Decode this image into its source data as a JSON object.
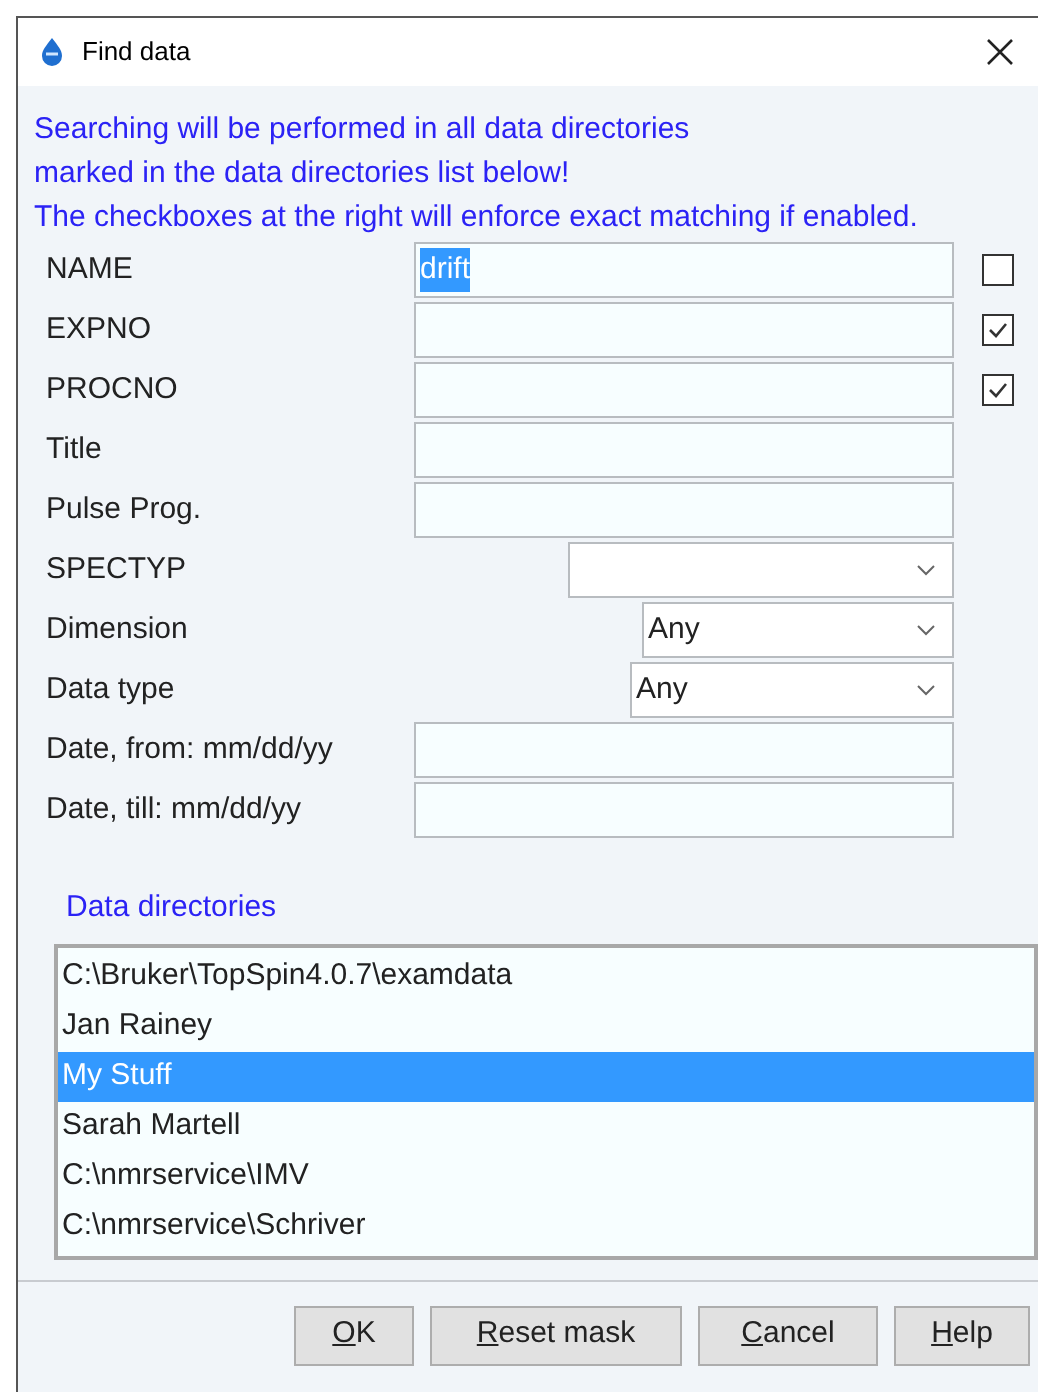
{
  "window": {
    "title": "Find data"
  },
  "info_lines": [
    "Searching will be performed in all data directories",
    "marked in the data directories list below!",
    "The checkboxes at the right will enforce exact matching if enabled."
  ],
  "fields": [
    {
      "kind": "text",
      "label": "NAME",
      "value": "drift",
      "value_highlighted": true,
      "exact_match": {
        "checked": false
      }
    },
    {
      "kind": "text",
      "label": "EXPNO",
      "exact_match": {
        "checked": true
      }
    },
    {
      "kind": "text",
      "label": "PROCNO",
      "exact_match": {
        "checked": true
      }
    },
    {
      "kind": "text",
      "label": "Title"
    },
    {
      "kind": "text",
      "label": "Pulse Prog."
    },
    {
      "kind": "select",
      "label": "SPECTYP"
    },
    {
      "kind": "select",
      "label": "Dimension",
      "value": "Any"
    },
    {
      "kind": "select",
      "label": "Data type",
      "value": "Any"
    },
    {
      "kind": "text",
      "label": "Date, from: mm/dd/yy"
    },
    {
      "kind": "text",
      "label": "Date, till: mm/dd/yy"
    }
  ],
  "data_directories": {
    "title": "Data directories",
    "items": [
      {
        "label": "C:\\Bruker\\TopSpin4.0.7\\examdata",
        "selected": false
      },
      {
        "label": "Jan Rainey",
        "selected": false
      },
      {
        "label": "My Stuff",
        "selected": true
      },
      {
        "label": "Sarah Martell",
        "selected": false
      },
      {
        "label": "C:\\nmrservice\\IMV",
        "selected": false
      },
      {
        "label": "C:\\nmrservice\\Schriver",
        "selected": false
      }
    ]
  },
  "buttons": [
    "OK",
    "Reset mask",
    "Cancel",
    "Help"
  ]
}
